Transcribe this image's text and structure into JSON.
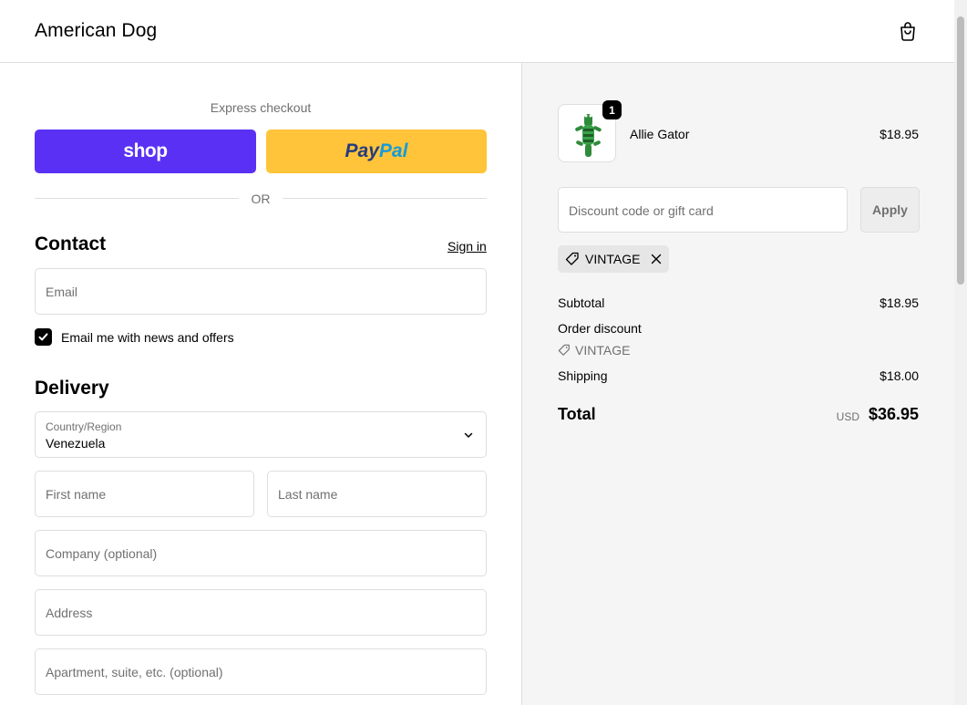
{
  "header": {
    "store_name": "American Dog",
    "cart_icon": "shopping-bag-icon"
  },
  "express": {
    "label": "Express checkout",
    "shop_label": "shop",
    "paypal_part1": "Pay",
    "paypal_part2": "Pal",
    "or_text": "OR",
    "colors": {
      "shop": "#5a31f4",
      "paypal": "#ffc439"
    }
  },
  "contact": {
    "title": "Contact",
    "signin_label": "Sign in",
    "email_placeholder": "Email",
    "newsletter_label": "Email me with news and offers",
    "newsletter_checked": true
  },
  "delivery": {
    "title": "Delivery",
    "country_label": "Country/Region",
    "country_value": "Venezuela",
    "first_name_placeholder": "First name",
    "last_name_placeholder": "Last name",
    "company_placeholder": "Company (optional)",
    "address_placeholder": "Address",
    "apartment_placeholder": "Apartment, suite, etc. (optional)"
  },
  "summary": {
    "item": {
      "name": "Allie Gator",
      "price": "$18.95",
      "quantity": "1"
    },
    "discount_placeholder": "Discount code or gift card",
    "apply_label": "Apply",
    "applied_code": "VINTAGE",
    "subtotal_label": "Subtotal",
    "subtotal_value": "$18.95",
    "order_discount_label": "Order discount",
    "order_discount_code": "VINTAGE",
    "shipping_label": "Shipping",
    "shipping_value": "$18.00",
    "total_label": "Total",
    "total_currency": "USD",
    "total_value": "$36.95"
  }
}
